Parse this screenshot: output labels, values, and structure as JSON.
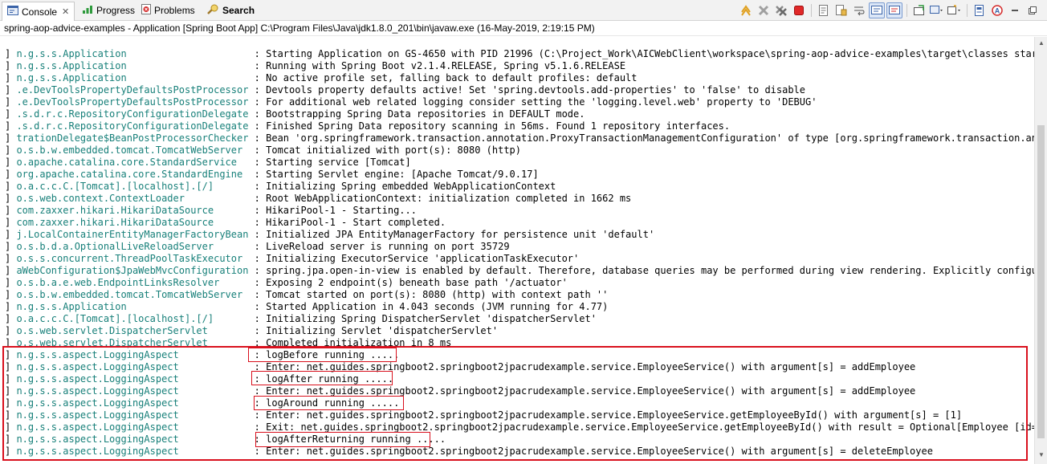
{
  "tabs": [
    {
      "label": "Console",
      "icon": "console-icon",
      "close": "✕"
    },
    {
      "label": "Progress",
      "icon": "progress-icon"
    },
    {
      "label": "Problems",
      "icon": "problems-icon"
    },
    {
      "label": "Search",
      "icon": "search-icon"
    }
  ],
  "process_label": "spring-aop-advice-examples - Application [Spring Boot App] C:\\Program Files\\Java\\jdk1.8.0_201\\bin\\javaw.exe (16-May-2019, 2:19:15 PM)",
  "toolbar_icons": [
    "skip-all-breakpoints-icon",
    "terminate-icon",
    "remove-all-terminated-icon",
    "stop-icon",
    "clear-console-icon",
    "scroll-lock-icon",
    "word-wrap-icon",
    "show-on-stdout-icon",
    "show-on-stderr-icon",
    "pin-console-icon",
    "display-selected-console-icon",
    "open-console-icon",
    "minimize-icon",
    "maximize-icon"
  ],
  "colors": {
    "logger": "#18807a",
    "highlight": "#d9101d",
    "text": "#000000"
  },
  "log_lines": [
    {
      "prefix": "] ",
      "logger": "n.g.s.s.Application                     ",
      "msg": ": Starting Application on GS-4650 with PID 21996 (C:\\Project_Work\\AICWebClient\\workspace\\spring-aop-advice-examples\\target\\classes started"
    },
    {
      "prefix": "] ",
      "logger": "n.g.s.s.Application                     ",
      "msg": ": Running with Spring Boot v2.1.4.RELEASE, Spring v5.1.6.RELEASE"
    },
    {
      "prefix": "] ",
      "logger": "n.g.s.s.Application                     ",
      "msg": ": No active profile set, falling back to default profiles: default"
    },
    {
      "prefix": "] ",
      "logger": ".e.DevToolsPropertyDefaultsPostProcessor",
      "msg": ": Devtools property defaults active! Set 'spring.devtools.add-properties' to 'false' to disable"
    },
    {
      "prefix": "] ",
      "logger": ".e.DevToolsPropertyDefaultsPostProcessor",
      "msg": ": For additional web related logging consider setting the 'logging.level.web' property to 'DEBUG'"
    },
    {
      "prefix": "] ",
      "logger": ".s.d.r.c.RepositoryConfigurationDelegate",
      "msg": ": Bootstrapping Spring Data repositories in DEFAULT mode."
    },
    {
      "prefix": "] ",
      "logger": ".s.d.r.c.RepositoryConfigurationDelegate",
      "msg": ": Finished Spring Data repository scanning in 56ms. Found 1 repository interfaces."
    },
    {
      "prefix": "] ",
      "logger": "trationDelegate$BeanPostProcessorChecker",
      "msg": ": Bean 'org.springframework.transaction.annotation.ProxyTransactionManagementConfiguration' of type [org.springframework.transaction.annota"
    },
    {
      "prefix": "] ",
      "logger": "o.s.b.w.embedded.tomcat.TomcatWebServer ",
      "msg": ": Tomcat initialized with port(s): 8080 (http)"
    },
    {
      "prefix": "] ",
      "logger": "o.apache.catalina.core.StandardService  ",
      "msg": ": Starting service [Tomcat]"
    },
    {
      "prefix": "] ",
      "logger": "org.apache.catalina.core.StandardEngine ",
      "msg": ": Starting Servlet engine: [Apache Tomcat/9.0.17]"
    },
    {
      "prefix": "] ",
      "logger": "o.a.c.c.C.[Tomcat].[localhost].[/]      ",
      "msg": ": Initializing Spring embedded WebApplicationContext"
    },
    {
      "prefix": "] ",
      "logger": "o.s.web.context.ContextLoader           ",
      "msg": ": Root WebApplicationContext: initialization completed in 1662 ms"
    },
    {
      "prefix": "] ",
      "logger": "com.zaxxer.hikari.HikariDataSource      ",
      "msg": ": HikariPool-1 - Starting..."
    },
    {
      "prefix": "] ",
      "logger": "com.zaxxer.hikari.HikariDataSource      ",
      "msg": ": HikariPool-1 - Start completed."
    },
    {
      "prefix": "] ",
      "logger": "j.LocalContainerEntityManagerFactoryBean",
      "msg": ": Initialized JPA EntityManagerFactory for persistence unit 'default'"
    },
    {
      "prefix": "] ",
      "logger": "o.s.b.d.a.OptionalLiveReloadServer      ",
      "msg": ": LiveReload server is running on port 35729"
    },
    {
      "prefix": "] ",
      "logger": "o.s.s.concurrent.ThreadPoolTaskExecutor ",
      "msg": ": Initializing ExecutorService 'applicationTaskExecutor'"
    },
    {
      "prefix": "] ",
      "logger": "aWebConfiguration$JpaWebMvcConfiguration",
      "msg": ": spring.jpa.open-in-view is enabled by default. Therefore, database queries may be performed during view rendering. Explicitly configure s"
    },
    {
      "prefix": "] ",
      "logger": "o.s.b.a.e.web.EndpointLinksResolver     ",
      "msg": ": Exposing 2 endpoint(s) beneath base path '/actuator'"
    },
    {
      "prefix": "] ",
      "logger": "o.s.b.w.embedded.tomcat.TomcatWebServer ",
      "msg": ": Tomcat started on port(s): 8080 (http) with context path ''"
    },
    {
      "prefix": "] ",
      "logger": "n.g.s.s.Application                     ",
      "msg": ": Started Application in 4.043 seconds (JVM running for 4.77)"
    },
    {
      "prefix": "] ",
      "logger": "o.a.c.c.C.[Tomcat].[localhost].[/]      ",
      "msg": ": Initializing Spring DispatcherServlet 'dispatcherServlet'"
    },
    {
      "prefix": "] ",
      "logger": "o.s.web.servlet.DispatcherServlet       ",
      "msg": ": Initializing Servlet 'dispatcherServlet'"
    },
    {
      "prefix": "] ",
      "logger": "o.s.web.servlet.DispatcherServlet       ",
      "msg": ": Completed initialization in 8 ms"
    },
    {
      "prefix": "] ",
      "logger": "n.g.s.s.aspect.LoggingAspect            ",
      "msg": ": logBefore running ....."
    },
    {
      "prefix": "] ",
      "logger": "n.g.s.s.aspect.LoggingAspect            ",
      "msg": ": Enter: net.guides.springboot2.springboot2jpacrudexample.service.EmployeeService() with argument[s] = addEmployee"
    },
    {
      "prefix": "] ",
      "logger": "n.g.s.s.aspect.LoggingAspect            ",
      "msg": ": logAfter running ....."
    },
    {
      "prefix": "] ",
      "logger": "n.g.s.s.aspect.LoggingAspect            ",
      "msg": ": Enter: net.guides.springboot2.springboot2jpacrudexample.service.EmployeeService() with argument[s] = addEmployee"
    },
    {
      "prefix": "] ",
      "logger": "n.g.s.s.aspect.LoggingAspect            ",
      "msg": ": logAround running ....."
    },
    {
      "prefix": "] ",
      "logger": "n.g.s.s.aspect.LoggingAspect            ",
      "msg": ": Enter: net.guides.springboot2.springboot2jpacrudexample.service.EmployeeService.getEmployeeById() with argument[s] = [1]"
    },
    {
      "prefix": "] ",
      "logger": "n.g.s.s.aspect.LoggingAspect            ",
      "msg": ": Exit: net.guides.springboot2.springboot2jpacrudexample.service.EmployeeService.getEmployeeById() with result = Optional[Employee [id=1, f"
    },
    {
      "prefix": "] ",
      "logger": "n.g.s.s.aspect.LoggingAspect            ",
      "msg": ": logAfterReturning running ....."
    },
    {
      "prefix": "] ",
      "logger": "n.g.s.s.aspect.LoggingAspect            ",
      "msg": ": Enter: net.guides.springboot2.springboot2jpacrudexample.service.EmployeeService() with argument[s] = deleteEmployee"
    }
  ]
}
